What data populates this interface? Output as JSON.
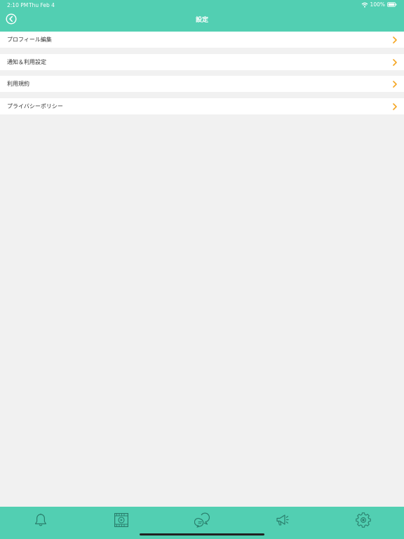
{
  "status_bar": {
    "time": "2:10 PM",
    "date": "Thu Feb 4",
    "battery_text": "100%"
  },
  "header": {
    "title": "設定",
    "back_icon": "chevron-left-circle-icon"
  },
  "settings_items": [
    {
      "label": "プロフィール編集"
    },
    {
      "label": "通知＆利用設定"
    },
    {
      "label": "利用規約"
    },
    {
      "label": "プライバシーポリシー"
    }
  ],
  "tabs": [
    {
      "icon": "bell-icon"
    },
    {
      "icon": "video-icon"
    },
    {
      "icon": "chat-icon"
    },
    {
      "icon": "megaphone-icon"
    },
    {
      "icon": "gear-icon"
    }
  ],
  "colors": {
    "header_bg": "#52cfb2",
    "background": "#f1f1f1",
    "chevron": "#f5a623",
    "icon_stroke": "#2a7e6c"
  }
}
